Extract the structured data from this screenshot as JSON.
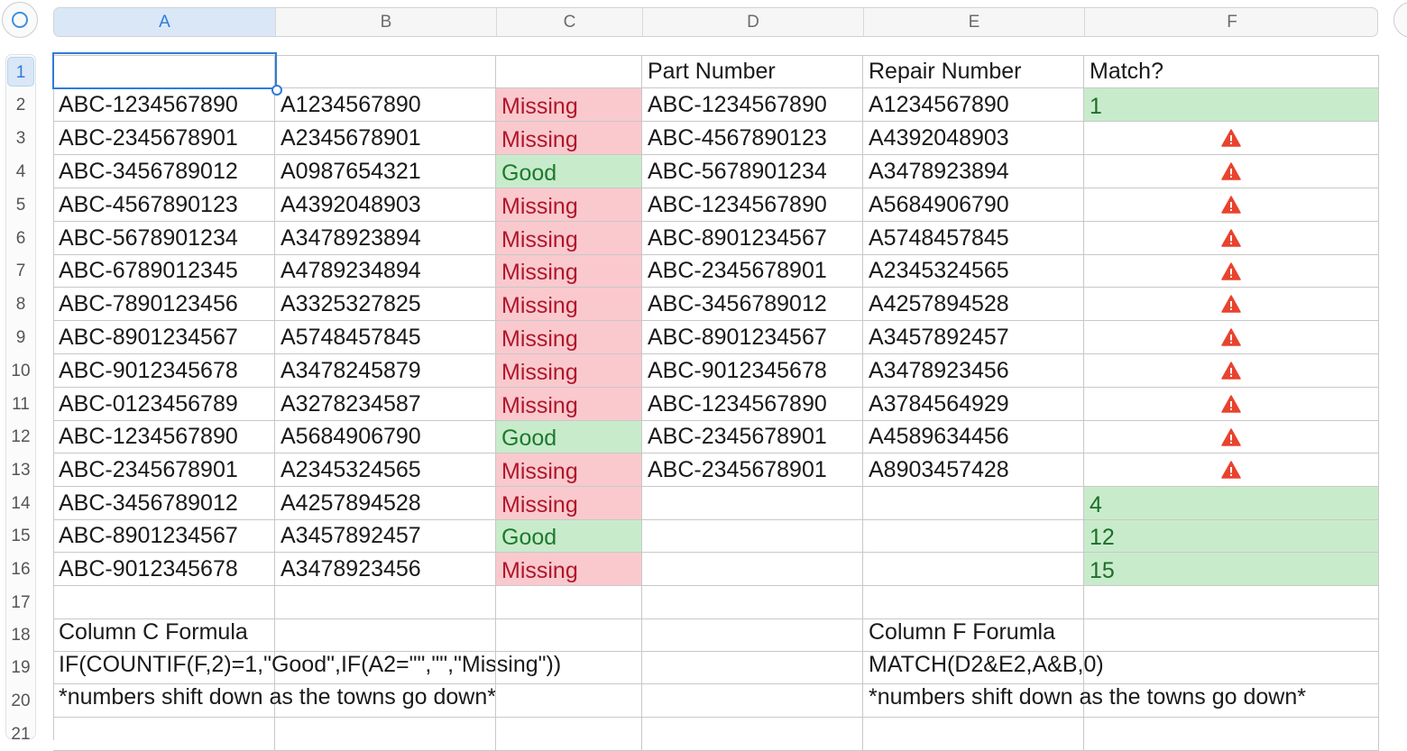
{
  "columns": [
    "A",
    "B",
    "C",
    "D",
    "E",
    "F"
  ],
  "selected_column": "A",
  "selected_row": 1,
  "row_numbers": [
    1,
    2,
    3,
    4,
    5,
    6,
    7,
    8,
    9,
    10,
    11,
    12,
    13,
    14,
    15,
    16,
    17,
    18,
    19,
    20,
    21
  ],
  "cells": {
    "r1": {
      "A": "",
      "B": "",
      "C": "",
      "D": "Part Number",
      "E": "Repair Number",
      "F": "Match?"
    },
    "r2": {
      "A": "ABC-1234567890",
      "B": "A1234567890",
      "C": "Missing",
      "D": "ABC-1234567890",
      "E": "A1234567890",
      "F": "1"
    },
    "r3": {
      "A": "ABC-2345678901",
      "B": "A2345678901",
      "C": "Missing",
      "D": "ABC-4567890123",
      "E": "A4392048903",
      "F": ""
    },
    "r4": {
      "A": "ABC-3456789012",
      "B": "A0987654321",
      "C": "Good",
      "D": "ABC-5678901234",
      "E": "A3478923894",
      "F": ""
    },
    "r5": {
      "A": "ABC-4567890123",
      "B": "A4392048903",
      "C": "Missing",
      "D": "ABC-1234567890",
      "E": "A5684906790",
      "F": ""
    },
    "r6": {
      "A": "ABC-5678901234",
      "B": "A3478923894",
      "C": "Missing",
      "D": "ABC-8901234567",
      "E": "A5748457845",
      "F": ""
    },
    "r7": {
      "A": "ABC-6789012345",
      "B": "A4789234894",
      "C": "Missing",
      "D": "ABC-2345678901",
      "E": "A2345324565",
      "F": ""
    },
    "r8": {
      "A": "ABC-7890123456",
      "B": "A3325327825",
      "C": "Missing",
      "D": "ABC-3456789012",
      "E": "A4257894528",
      "F": ""
    },
    "r9": {
      "A": "ABC-8901234567",
      "B": "A5748457845",
      "C": "Missing",
      "D": "ABC-8901234567",
      "E": "A3457892457",
      "F": ""
    },
    "r10": {
      "A": "ABC-9012345678",
      "B": "A3478245879",
      "C": "Missing",
      "D": "ABC-9012345678",
      "E": "A3478923456",
      "F": ""
    },
    "r11": {
      "A": "ABC-0123456789",
      "B": "A3278234587",
      "C": "Missing",
      "D": "ABC-1234567890",
      "E": "A3784564929",
      "F": ""
    },
    "r12": {
      "A": "ABC-1234567890",
      "B": "A5684906790",
      "C": "Good",
      "D": "ABC-2345678901",
      "E": "A4589634456",
      "F": ""
    },
    "r13": {
      "A": "ABC-2345678901",
      "B": "A2345324565",
      "C": "Missing",
      "D": "ABC-2345678901",
      "E": "A8903457428",
      "F": ""
    },
    "r14": {
      "A": "ABC-3456789012",
      "B": "A4257894528",
      "C": "Missing",
      "D": "",
      "E": "",
      "F": "4"
    },
    "r15": {
      "A": "ABC-8901234567",
      "B": "A3457892457",
      "C": "Good",
      "D": "",
      "E": "",
      "F": "12"
    },
    "r16": {
      "A": "ABC-9012345678",
      "B": "A3478923456",
      "C": "Missing",
      "D": "",
      "E": "",
      "F": "15"
    },
    "r17": {
      "A": "",
      "B": "",
      "C": "",
      "D": "",
      "E": "",
      "F": ""
    },
    "r18": {
      "A": "Column C Formula",
      "B": "",
      "C": "",
      "D": "",
      "E": "Column F Forumla",
      "F": ""
    },
    "r19": {
      "A": "IF(COUNTIF(F,2)=1,\"Good\",IF(A2=\"\",\"\",\"Missing\"))",
      "B": "",
      "C": "",
      "D": "",
      "E": "MATCH(D2&E2,A&B,0)",
      "F": ""
    },
    "r20": {
      "A": "*numbers shift down as the towns go down*",
      "B": "",
      "C": "",
      "D": "",
      "E": "*numbers shift down as the towns go down*",
      "F": ""
    },
    "r21": {
      "A": "",
      "B": "",
      "C": "",
      "D": "",
      "E": "",
      "F": ""
    }
  },
  "warning_rows": [
    3,
    4,
    5,
    6,
    7,
    8,
    9,
    10,
    11,
    12,
    13
  ],
  "warning_icon": "warning-triangle-icon",
  "colors": {
    "missing_fill": "#f9c9ce",
    "missing_text": "#b0162a",
    "good_fill": "#c8eccb",
    "good_text": "#1d7a2e",
    "warning_icon": "#e8432e",
    "selection": "#2f7bd8"
  }
}
